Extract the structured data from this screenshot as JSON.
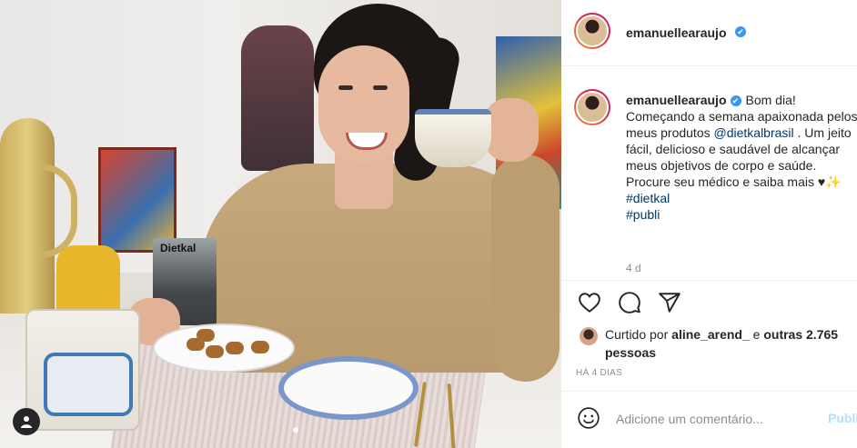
{
  "post": {
    "username": "emanuellearaujo",
    "verified_icon": "✔",
    "photo_tag_text": "Dietkal"
  },
  "caption": {
    "username": "emanuellearaujo",
    "text_before_mention": "Bom dia! Começando a semana apaixonada pelos meus produtos",
    "mention": "@dietkalbrasil",
    "text_after_mention": ". Um jeito fácil, delicioso e saudável de alcançar meus objetivos de corpo e saúde. Procure seu médico e saiba mais ♥✨",
    "hashtags": [
      "#dietkal",
      "#publi"
    ],
    "time": "4 d"
  },
  "actions": {
    "like_icon": "heart-icon",
    "comment_icon": "comment-icon",
    "share_icon": "share-icon"
  },
  "likes": {
    "prefix": "Curtido por",
    "user": "aline_arend_",
    "connector": "e",
    "others": "outras 2.765 pessoas"
  },
  "post_date": "HÁ 4 DIAS",
  "comment_box": {
    "placeholder": "Adicione um comentário...",
    "publish_label": "Publi"
  },
  "colors": {
    "link": "#00376b",
    "verified": "#3897f0",
    "muted": "#8e8e8e",
    "publish_disabled": "#b2dffc"
  }
}
